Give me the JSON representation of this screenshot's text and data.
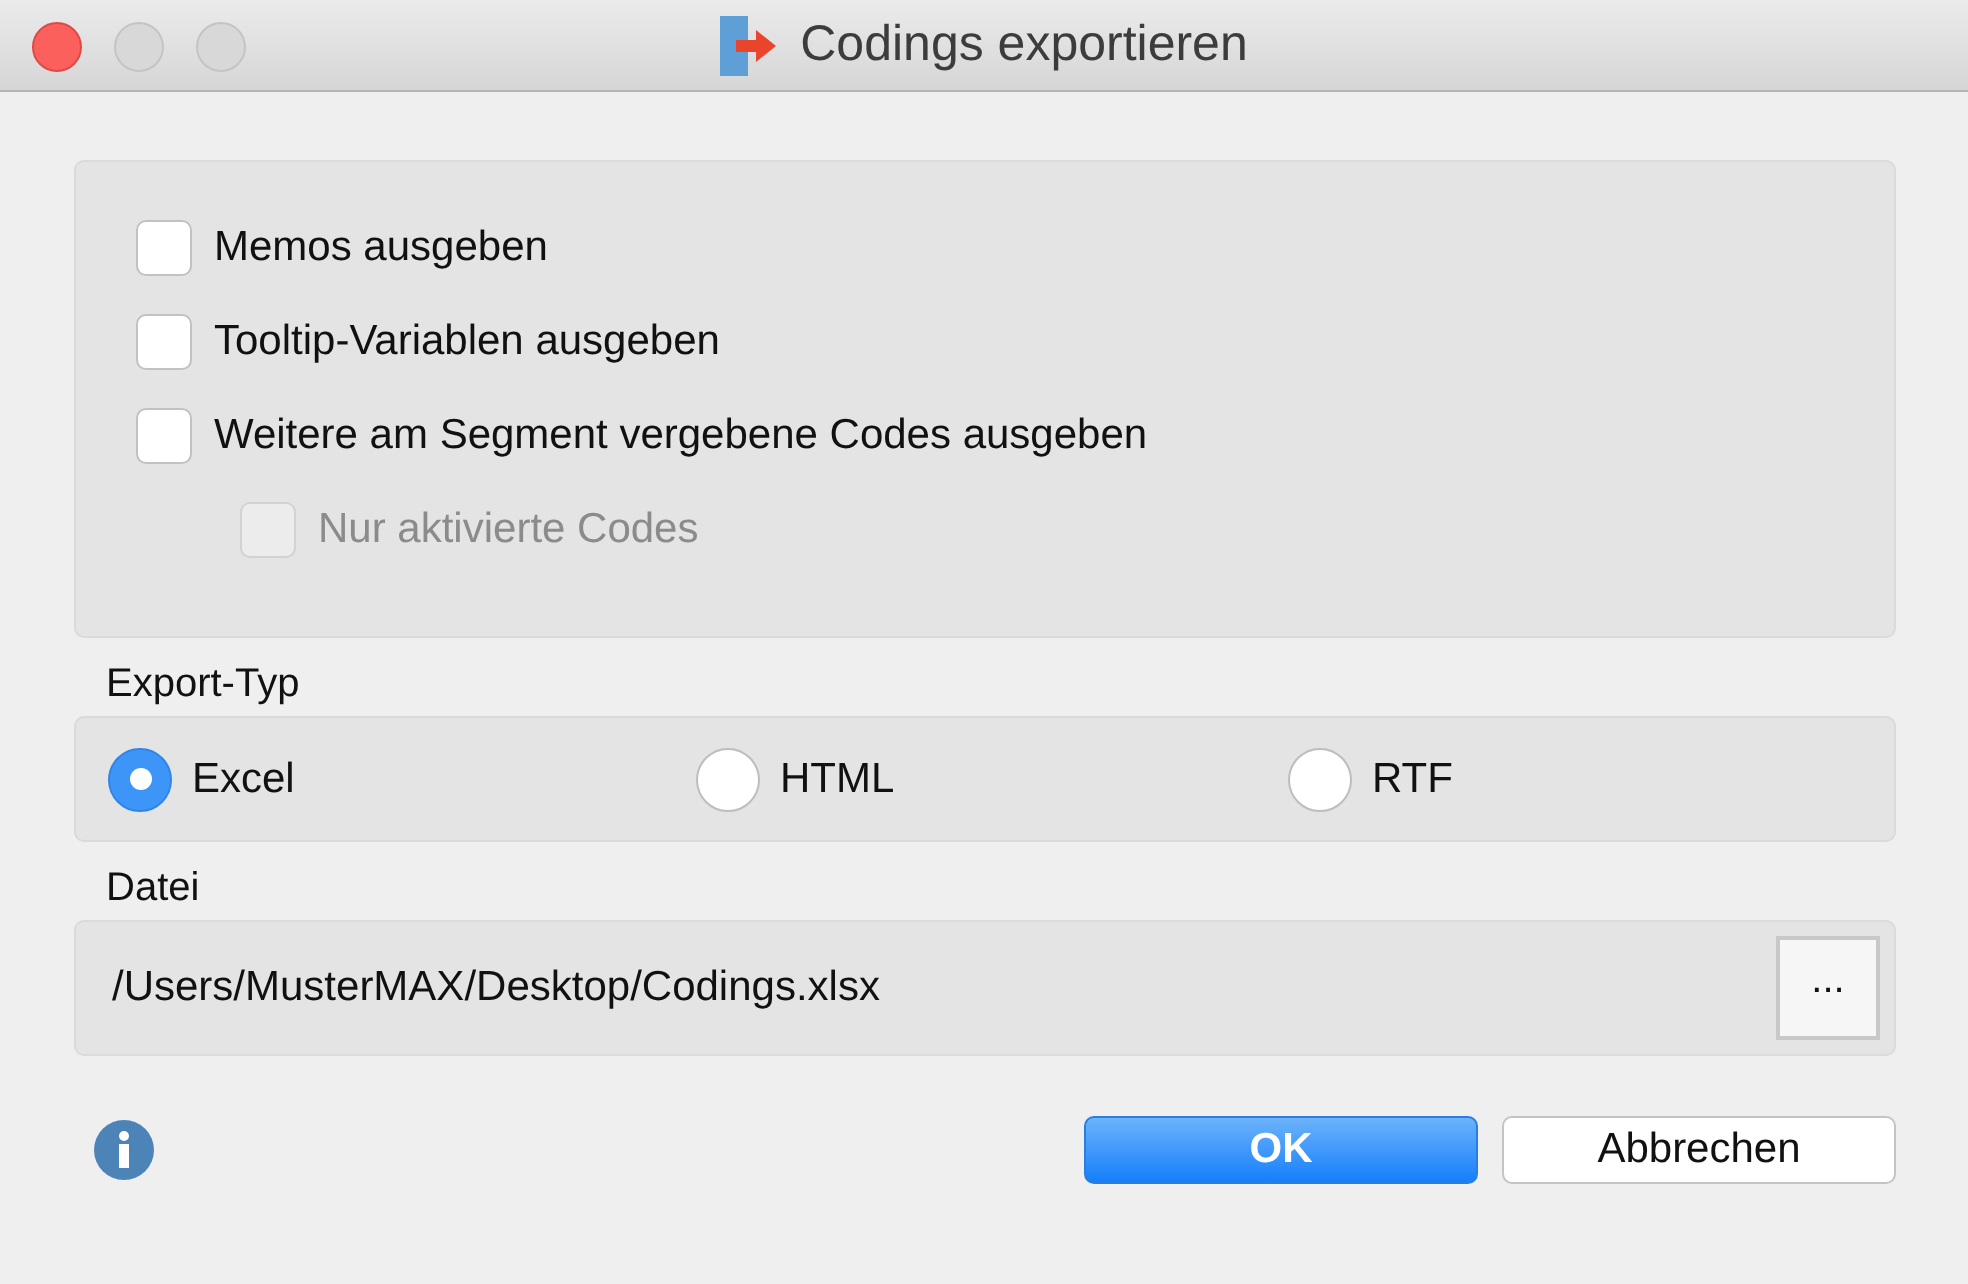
{
  "window": {
    "title": "Codings exportieren"
  },
  "options": [
    {
      "label": "Memos ausgeben",
      "checked": false,
      "disabled": false
    },
    {
      "label": "Tooltip-Variablen ausgeben",
      "checked": false,
      "disabled": false
    },
    {
      "label": "Weitere am Segment vergebene Codes ausgeben",
      "checked": false,
      "disabled": false,
      "children": [
        {
          "label": "Nur aktivierte Codes",
          "checked": false,
          "disabled": true
        }
      ]
    }
  ],
  "export_type": {
    "label": "Export-Typ",
    "options": [
      {
        "label": "Excel",
        "selected": true
      },
      {
        "label": "HTML",
        "selected": false
      },
      {
        "label": "RTF",
        "selected": false
      }
    ]
  },
  "file": {
    "label": "Datei",
    "value": "/Users/MusterMAX/Desktop/Codings.xlsx",
    "browse_button": "..."
  },
  "buttons": [
    {
      "label": "OK",
      "kind": "primary"
    },
    {
      "label": "Abbrechen",
      "kind": "secondary"
    }
  ]
}
